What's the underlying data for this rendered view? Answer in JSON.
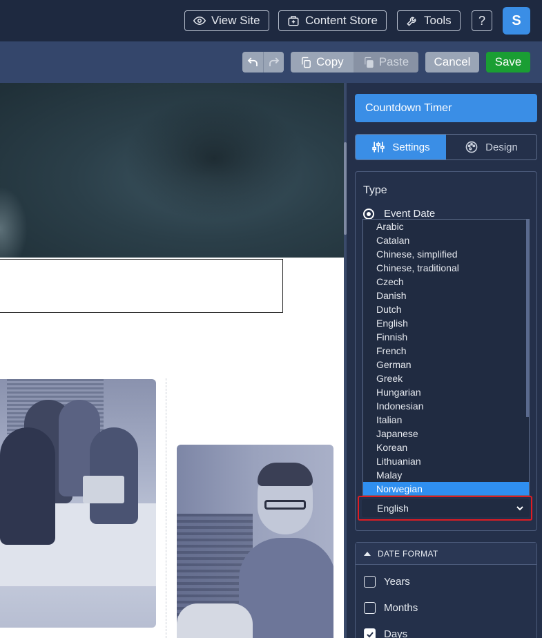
{
  "topbar": {
    "view_site": "View Site",
    "content_store": "Content Store",
    "tools": "Tools",
    "help": "?",
    "avatar_initial": "S"
  },
  "toolbar": {
    "copy": "Copy",
    "paste": "Paste",
    "cancel": "Cancel",
    "save": "Save"
  },
  "panel": {
    "title": "Countdown Timer",
    "tabs": [
      {
        "label": "Settings",
        "icon": "sliders-icon",
        "active": true
      },
      {
        "label": "Design",
        "icon": "palette-icon",
        "active": false
      }
    ],
    "type_label": "Type",
    "radio_label": "Event Date",
    "language_options": [
      "Arabic",
      "Catalan",
      "Chinese, simplified",
      "Chinese, traditional",
      "Czech",
      "Danish",
      "Dutch",
      "English",
      "Finnish",
      "French",
      "German",
      "Greek",
      "Hungarian",
      "Indonesian",
      "Italian",
      "Japanese",
      "Korean",
      "Lithuanian",
      "Malay",
      "Norwegian"
    ],
    "highlighted_option": "Norwegian",
    "selected_language": "English",
    "date_format": {
      "header": "DATE FORMAT",
      "items": [
        {
          "label": "Years",
          "checked": false
        },
        {
          "label": "Months",
          "checked": false
        },
        {
          "label": "Days",
          "checked": true
        }
      ]
    }
  },
  "colors": {
    "accent": "#3a8ee6",
    "save": "#1a9e33",
    "highlight_outline": "#e01c22"
  }
}
